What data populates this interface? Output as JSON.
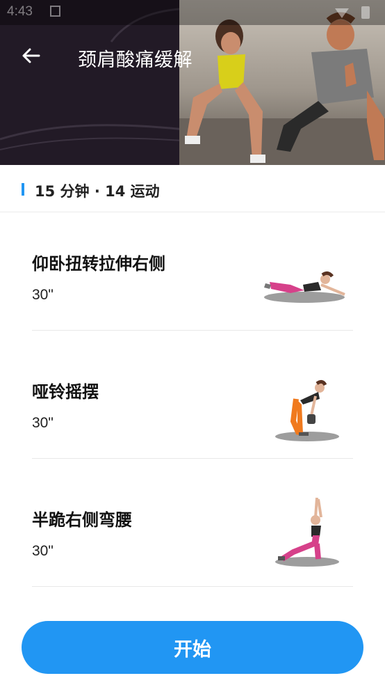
{
  "status_bar": {
    "time": "4:43"
  },
  "header": {
    "title": "颈肩酸痛缓解",
    "back_icon": "arrow-left-icon"
  },
  "summary": {
    "text": "15 分钟 · 14 运动"
  },
  "exercises": [
    {
      "name": "仰卧扭转拉伸右侧",
      "duration": "30\""
    },
    {
      "name": "哑铃摇摆",
      "duration": "30\""
    },
    {
      "name": "半跪右侧弯腰",
      "duration": "30\""
    }
  ],
  "start_button": {
    "label": "开始"
  },
  "colors": {
    "accent": "#2196f3",
    "header_bg": "#221a26"
  }
}
